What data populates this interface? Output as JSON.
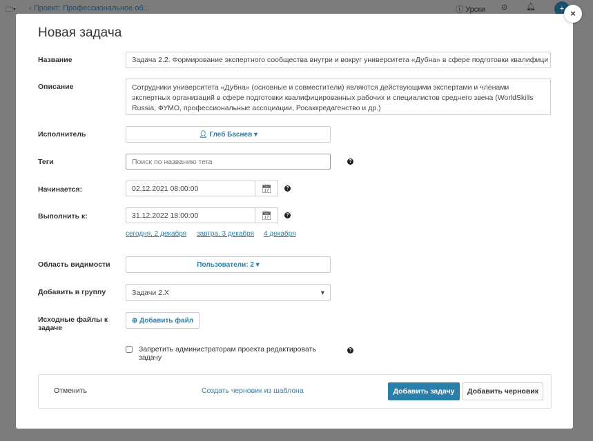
{
  "topbar": {
    "breadcrumb": "‹ Проект: Профессиональное об...",
    "lessons": "Урски"
  },
  "modal": {
    "title": "Новая задача",
    "name": {
      "label": "Название",
      "value": "Задача 2.2. Формирование экспертного сообщества внутри и вокруг университета «Дубна» в сфере подготовки квалифици"
    },
    "description": {
      "label": "Описание",
      "value": "Сотрудники университета «Дубна» (основные и совместители) являются действующими экспертами и членами экспертных организаций в сфере подготовки квалифицированных рабочих и специалистов среднего звена (WorldSkills Russia, ФУМО, профессиональные ассоциации, Росаккредагенство и др.)"
    },
    "assignee": {
      "label": "Исполнитель",
      "value": "Глеб Баснев"
    },
    "tags": {
      "label": "Теги",
      "placeholder": "Поиск по названию тега"
    },
    "start": {
      "label": "Начинается:",
      "value": "02.12.2021 08:00:00"
    },
    "due": {
      "label": "Выполнить к:",
      "value": "31.12.2022 18:00:00",
      "quick": [
        "сегодня, 2 декабря",
        "завтра, 3 декабря",
        "4 декабря"
      ]
    },
    "visibility": {
      "label": "Область видимости",
      "value": "Пользователи: 2"
    },
    "group": {
      "label": "Добавить в группу",
      "value": "Задачи 2.X"
    },
    "files": {
      "label": "Исходные файлы к задаче",
      "button": "Добавить файл"
    },
    "restrict": {
      "label": "Запретить администраторам проекта редактировать задачу",
      "checked": false
    },
    "footer": {
      "cancel": "Отменить",
      "template": "Создать черновик из шаблона",
      "add": "Добавить задачу",
      "draft": "Добавить черновик"
    }
  },
  "colors": {
    "accent": "#2a7fa8",
    "primary_button": "#2a7fa8"
  }
}
